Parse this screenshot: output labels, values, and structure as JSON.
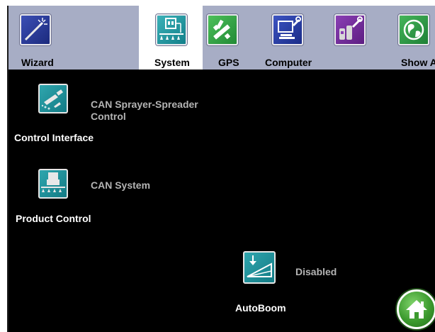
{
  "tabs": [
    {
      "label": "Wizard",
      "icon": "wand-icon",
      "active": false
    },
    {
      "label": "System",
      "icon": "sprayer-system-icon",
      "active": true
    },
    {
      "label": "GPS",
      "icon": "gps-tools-icon",
      "active": false
    },
    {
      "label": "Computer",
      "icon": "computer-icon",
      "active": false
    },
    {
      "label": "",
      "icon": "tools-icon",
      "active": false
    },
    {
      "label": "Show All",
      "icon": "globe-icon",
      "active": false
    }
  ],
  "items": [
    {
      "label": "Control Interface",
      "status": "CAN Sprayer-Spreader Control",
      "icon": "sprayer-nozzle-icon"
    },
    {
      "label": "Product Control",
      "status": "CAN System",
      "icon": "product-control-icon"
    },
    {
      "label": "AutoBoom",
      "status": "Disabled",
      "icon": "autoboom-icon"
    }
  ],
  "home": {
    "icon": "home-icon"
  },
  "colors": {
    "background": "#000000",
    "tabbar": "#a7adc5",
    "active_tab": "#ffffff",
    "item_label": "#ffffff",
    "item_status": "#b4b4b4",
    "home_button": "#3c9a2e"
  }
}
